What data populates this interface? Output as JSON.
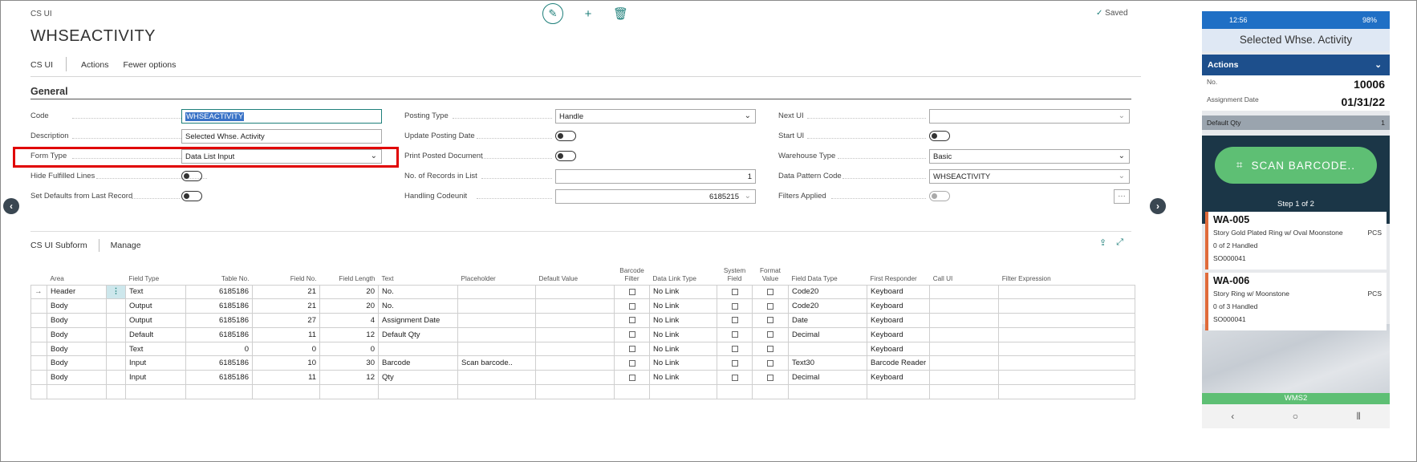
{
  "page": {
    "breadcrumb": "CS UI",
    "title": "WHSEACTIVITY",
    "saved": "Saved"
  },
  "actions": [
    "CS UI",
    "Actions",
    "Fewer options"
  ],
  "general": {
    "title": "General",
    "col1": [
      {
        "label": "Code",
        "value": "WHSEACTIVITY",
        "type": "text"
      },
      {
        "label": "Description",
        "value": "Selected Whse. Activity",
        "type": "text"
      },
      {
        "label": "Form Type",
        "value": "Data List Input",
        "type": "select"
      },
      {
        "label": "Hide Fulfilled Lines",
        "type": "toggle"
      },
      {
        "label": "Set Defaults from Last Record",
        "type": "toggle"
      }
    ],
    "col2": [
      {
        "label": "Posting Type",
        "value": "Handle",
        "type": "select"
      },
      {
        "label": "Update Posting Date",
        "type": "toggle"
      },
      {
        "label": "Print Posted Document",
        "type": "toggle"
      },
      {
        "label": "No. of Records in List",
        "value": "1",
        "type": "number"
      },
      {
        "label": "Handling Codeunit",
        "value": "6185215",
        "type": "lookup"
      }
    ],
    "col3": [
      {
        "label": "Next UI",
        "value": "",
        "type": "lookup"
      },
      {
        "label": "Start UI",
        "type": "toggle"
      },
      {
        "label": "Warehouse Type",
        "value": "Basic",
        "type": "select"
      },
      {
        "label": "Data Pattern Code",
        "value": "WHSEACTIVITY",
        "type": "lookup"
      },
      {
        "label": "Filters Applied",
        "type": "toggle-disabled"
      }
    ]
  },
  "subform": {
    "title": "CS UI Subform",
    "manage": "Manage",
    "columns": [
      "Area",
      "Field Type",
      "Table No.",
      "Field No.",
      "Field Length",
      "Text",
      "Placeholder",
      "Default Value",
      "Barcode Filter",
      "Data Link Type",
      "System Field",
      "Format Value",
      "Field Data Type",
      "First Responder",
      "Call UI",
      "Filter Expression"
    ],
    "rows": [
      [
        "Header",
        "Text",
        "6185186",
        "21",
        "20",
        "No.",
        "",
        "",
        "",
        "No Link",
        "",
        "",
        "Code20",
        "Keyboard",
        "",
        ""
      ],
      [
        "Body",
        "Output",
        "6185186",
        "21",
        "20",
        "No.",
        "",
        "",
        "",
        "No Link",
        "",
        "",
        "Code20",
        "Keyboard",
        "",
        ""
      ],
      [
        "Body",
        "Output",
        "6185186",
        "27",
        "4",
        "Assignment Date",
        "",
        "",
        "",
        "No Link",
        "",
        "",
        "Date",
        "Keyboard",
        "",
        ""
      ],
      [
        "Body",
        "Default",
        "6185186",
        "11",
        "12",
        "Default Qty",
        "",
        "",
        "",
        "No Link",
        "",
        "",
        "Decimal",
        "Keyboard",
        "",
        ""
      ],
      [
        "Body",
        "Text",
        "0",
        "0",
        "0",
        "",
        "",
        "",
        "",
        "No Link",
        "",
        "",
        "",
        "Keyboard",
        "",
        ""
      ],
      [
        "Body",
        "Input",
        "6185186",
        "10",
        "30",
        "Barcode",
        "Scan barcode..",
        "",
        "",
        "No Link",
        "",
        "",
        "Text30",
        "Barcode Reader",
        "",
        ""
      ],
      [
        "Body",
        "Input",
        "6185186",
        "11",
        "12",
        "Qty",
        "",
        "",
        "",
        "No Link",
        "",
        "",
        "Decimal",
        "Keyboard",
        "",
        ""
      ]
    ]
  },
  "phone": {
    "time": "12:56",
    "battery": "98%",
    "title": "Selected Whse. Activity",
    "actions": "Actions",
    "no_label": "No.",
    "no_value": "10006",
    "date_label": "Assignment Date",
    "date_value": "01/31/22",
    "dq_label": "Default Qty",
    "dq_value": "1",
    "scan": "SCAN BARCODE..",
    "step": "Step 1 of 2",
    "cards": [
      {
        "title": "WA-005",
        "desc": "Story Gold Plated Ring w/ Oval Moonstone",
        "unit": "PCS",
        "handled": "0 of 2 Handled",
        "order": "SO000041"
      },
      {
        "title": "WA-006",
        "desc": "Story Ring w/ Moonstone",
        "unit": "PCS",
        "handled": "0 of 3 Handled",
        "order": "SO000041"
      }
    ],
    "footer": "WMS2"
  },
  "colors": {
    "accent": "#1e7f7a",
    "highlight_box": "#e00000",
    "phone_header": "#1d4f8c",
    "scan_button": "#5ebf74"
  }
}
